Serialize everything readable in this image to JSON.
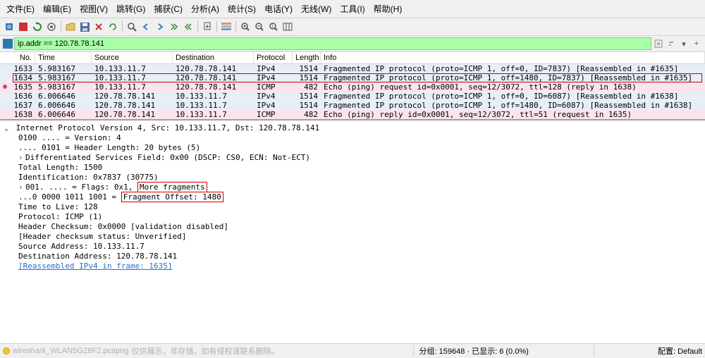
{
  "menu": {
    "file": "文件(E)",
    "edit": "编辑(E)",
    "view": "视图(V)",
    "goto": "跳转(G)",
    "capture": "捕获(C)",
    "analyze": "分析(A)",
    "statistics": "统计(S)",
    "telephony": "电话(Y)",
    "wireless": "无线(W)",
    "tools": "工具(I)",
    "help": "帮助(H)"
  },
  "filter": {
    "expression": "ip.addr == 120.78.78.141"
  },
  "columns": {
    "no": "No.",
    "time": "Time",
    "src": "Source",
    "dst": "Destination",
    "proto": "Protocol",
    "len": "Length",
    "info": "Info"
  },
  "packets": [
    {
      "no": "1633",
      "time": "5.983167",
      "src": "10.133.11.7",
      "dst": "120.78.78.141",
      "proto": "IPv4",
      "len": "1514",
      "info": "Fragmented IP protocol (proto=ICMP 1, off=0, ID=7837) [Reassembled in #1635]",
      "cls": "row-blue"
    },
    {
      "no": "1634",
      "time": "5.983167",
      "src": "10.133.11.7",
      "dst": "120.78.78.141",
      "proto": "IPv4",
      "len": "1514",
      "info": "Fragmented IP protocol (proto=ICMP 1, off=1480, ID=7837) [Reassembled in #1635]",
      "cls": "row-blue",
      "selected": true
    },
    {
      "no": "1635",
      "time": "5.983167",
      "src": "10.133.11.7",
      "dst": "120.78.78.141",
      "proto": "ICMP",
      "len": "482",
      "info": "Echo (ping) request  id=0x0001, seq=12/3072, ttl=128 (reply in 1638)",
      "cls": "row-pink",
      "dot": true
    },
    {
      "no": "1636",
      "time": "6.006646",
      "src": "120.78.78.141",
      "dst": "10.133.11.7",
      "proto": "IPv4",
      "len": "1514",
      "info": "Fragmented IP protocol (proto=ICMP 1, off=0, ID=6087) [Reassembled in #1638]",
      "cls": "row-blue"
    },
    {
      "no": "1637",
      "time": "6.006646",
      "src": "120.78.78.141",
      "dst": "10.133.11.7",
      "proto": "IPv4",
      "len": "1514",
      "info": "Fragmented IP protocol (proto=ICMP 1, off=1480, ID=6087) [Reassembled in #1638]",
      "cls": "row-blue"
    },
    {
      "no": "1638",
      "time": "6.006646",
      "src": "120.78.78.141",
      "dst": "10.133.11.7",
      "proto": "ICMP",
      "len": "482",
      "info": "Echo (ping) reply    id=0x0001, seq=12/3072, ttl=51 (request in 1635)",
      "cls": "row-pink"
    }
  ],
  "details": {
    "header": "Internet Protocol Version 4, Src: 10.133.11.7, Dst: 120.78.78.141",
    "version": "0100 .... = Version: 4",
    "hlen": ".... 0101 = Header Length: 20 bytes (5)",
    "dsf": "Differentiated Services Field: 0x00 (DSCP: CS0, ECN: Not-ECT)",
    "tlen": "Total Length: 1500",
    "id": "Identification: 0x7837 (30775)",
    "flags_prefix": "001. .... = Flags: 0x1, ",
    "flags_box": "More fragments",
    "fragoff_prefix": "...0 0000 1011 1001 = ",
    "fragoff_box": "Fragment Offset: 1480",
    "ttl": "Time to Live: 128",
    "protocol": "Protocol: ICMP (1)",
    "checksum": "Header Checksum: 0x0000 [validation disabled]",
    "checksum_status": "[Header checksum status: Unverified]",
    "srcaddr": "Source Address: 10.133.11.7",
    "dstaddr": "Destination Address: 120.78.78.141",
    "reasm": "[Reassembled IPv4 in frame: 1635]"
  },
  "status": {
    "file_hint": "wireshark_WLAN5GZ8F2.pcapng",
    "gray_hint": "仅供展示，非存储，如有侵权请联系删除。",
    "mid": "分组: 159648 · 已显示: 6 (0.0%)",
    "profile_label": "配置:",
    "profile_value": "Default"
  }
}
